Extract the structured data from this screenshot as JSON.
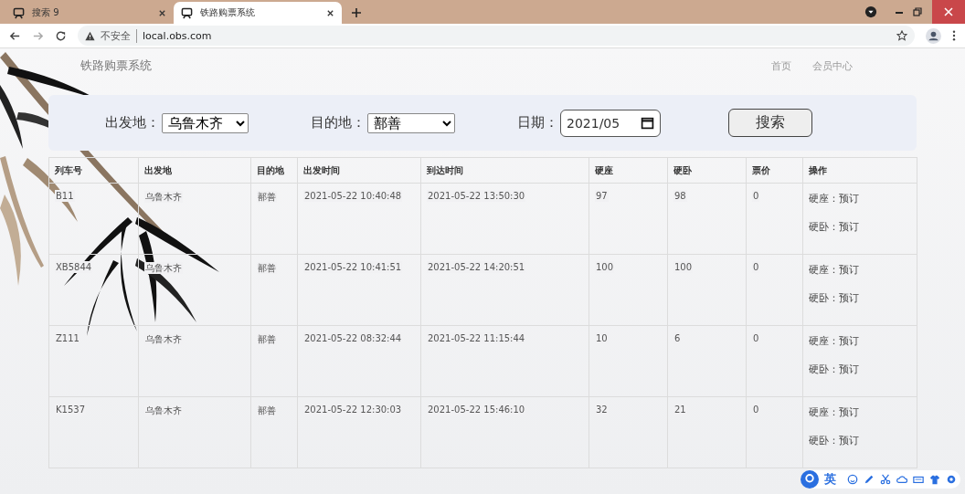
{
  "browser": {
    "tabs": [
      {
        "title": "搜索 9",
        "selected": false
      },
      {
        "title": "铁路购票系统",
        "selected": true
      }
    ],
    "address": {
      "security": "不安全",
      "url": "local.obs.com"
    }
  },
  "header": {
    "brand": "铁路购票系统",
    "nav": [
      "首页",
      "会员中心"
    ]
  },
  "search": {
    "from_label": "出发地：",
    "from_value": "乌鲁木齐",
    "to_label": "目的地：",
    "to_value": "鄯善",
    "date_label": "日期：",
    "date_value": "2021/05",
    "button": "搜索"
  },
  "table": {
    "columns": [
      "列车号",
      "出发地",
      "目的地",
      "出发时间",
      "到达时间",
      "硬座",
      "硬卧",
      "票价",
      "操作"
    ],
    "rows": [
      {
        "cells": [
          "B11",
          "乌鲁木齐",
          "鄯善",
          "2021-05-22 10:40:48",
          "2021-05-22 13:50:30",
          "97",
          "98",
          "0"
        ],
        "actions": [
          "硬座：预订",
          "硬卧：预订"
        ]
      },
      {
        "cells": [
          "XB5844",
          "乌鲁木齐",
          "鄯善",
          "2021-05-22 10:41:51",
          "2021-05-22 14:20:51",
          "100",
          "100",
          "0"
        ],
        "actions": [
          "硬座：预订",
          "硬卧：预订"
        ]
      },
      {
        "cells": [
          "Z111",
          "乌鲁木齐",
          "鄯善",
          "2021-05-22 08:32:44",
          "2021-05-22 11:15:44",
          "10",
          "6",
          "0"
        ],
        "actions": [
          "硬座：预订",
          "硬卧：预订"
        ]
      },
      {
        "cells": [
          "K1537",
          "乌鲁木齐",
          "鄯善",
          "2021-05-22 12:30:03",
          "2021-05-22 15:46:10",
          "32",
          "21",
          "0"
        ],
        "actions": [
          "硬座：预订",
          "硬卧：预订"
        ]
      }
    ]
  },
  "ime": {
    "mode": "英"
  }
}
